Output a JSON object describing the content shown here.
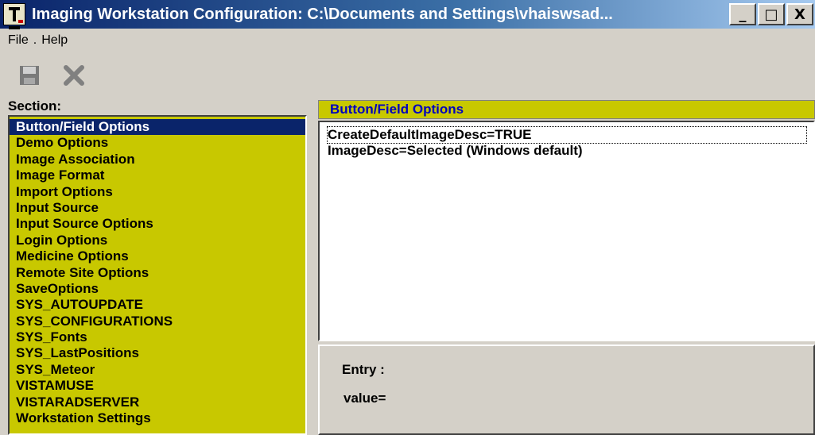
{
  "window": {
    "title": "Imaging Workstation Configuration:  C:\\Documents and Settings\\vhaiswsad...",
    "controls": {
      "minimize": "_",
      "maximize": "□",
      "close": "X"
    }
  },
  "menu": {
    "file": "File",
    "separator": ".",
    "help": "Help"
  },
  "toolbar": {
    "save_icon": "floppy-disk-icon",
    "cancel_icon": "x-icon"
  },
  "sections": {
    "label": "Section:",
    "items": [
      "Button/Field Options",
      "Demo Options",
      "Image Association",
      "Image Format",
      "Import Options",
      "Input Source",
      "Input Source Options",
      "Login Options",
      "Medicine Options",
      "Remote Site Options",
      "SaveOptions",
      "SYS_AUTOUPDATE",
      "SYS_CONFIGURATIONS",
      "SYS_Fonts",
      "SYS_LastPositions",
      "SYS_Meteor",
      "VISTAMUSE",
      "VISTARADSERVER",
      "Workstation Settings"
    ],
    "selected_index": 0
  },
  "options": {
    "header": "Button/Field Options",
    "items": [
      "CreateDefaultImageDesc=TRUE",
      "ImageDesc=Selected (Windows default)"
    ]
  },
  "entry": {
    "entry_label": "Entry :",
    "value_label": "value="
  },
  "colors": {
    "list_bg": "#c8c800",
    "selection": "#0a246a",
    "header_text": "#0000c0"
  }
}
